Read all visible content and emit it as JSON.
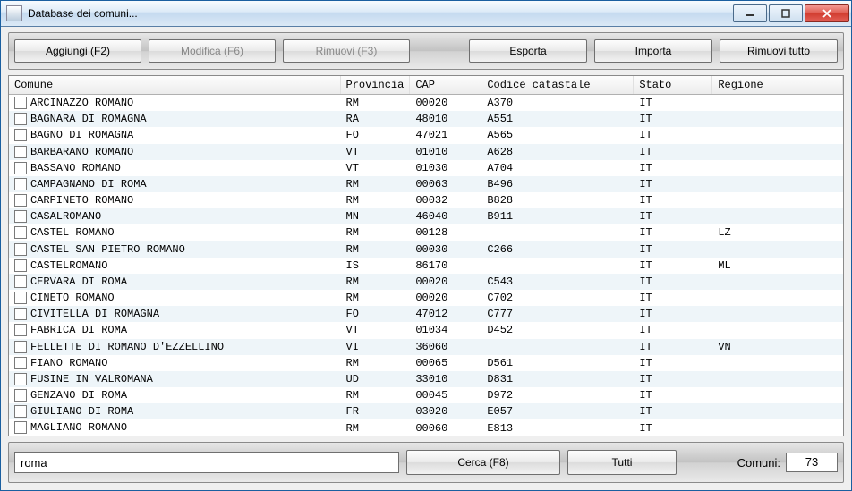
{
  "window": {
    "title": "Database dei comuni..."
  },
  "toolbar": {
    "aggiungi": "Aggiungi (F2)",
    "modifica": "Modifica (F6)",
    "rimuovi": "Rimuovi (F3)",
    "esporta": "Esporta",
    "importa": "Importa",
    "rimuovi_tutto": "Rimuovi tutto"
  },
  "columns": {
    "comune": "Comune",
    "provincia": "Provincia",
    "cap": "CAP",
    "codice": "Codice catastale",
    "stato": "Stato",
    "regione": "Regione"
  },
  "rows": [
    {
      "comune": "ARCINAZZO ROMANO",
      "provincia": "RM",
      "cap": "00020",
      "codice": "A370",
      "stato": "IT",
      "regione": ""
    },
    {
      "comune": "BAGNARA DI ROMAGNA",
      "provincia": "RA",
      "cap": "48010",
      "codice": "A551",
      "stato": "IT",
      "regione": ""
    },
    {
      "comune": "BAGNO DI ROMAGNA",
      "provincia": "FO",
      "cap": "47021",
      "codice": "A565",
      "stato": "IT",
      "regione": ""
    },
    {
      "comune": "BARBARANO ROMANO",
      "provincia": "VT",
      "cap": "01010",
      "codice": "A628",
      "stato": "IT",
      "regione": ""
    },
    {
      "comune": "BASSANO ROMANO",
      "provincia": "VT",
      "cap": "01030",
      "codice": "A704",
      "stato": "IT",
      "regione": ""
    },
    {
      "comune": "CAMPAGNANO DI ROMA",
      "provincia": "RM",
      "cap": "00063",
      "codice": "B496",
      "stato": "IT",
      "regione": ""
    },
    {
      "comune": "CARPINETO ROMANO",
      "provincia": "RM",
      "cap": "00032",
      "codice": "B828",
      "stato": "IT",
      "regione": ""
    },
    {
      "comune": "CASALROMANO",
      "provincia": "MN",
      "cap": "46040",
      "codice": "B911",
      "stato": "IT",
      "regione": ""
    },
    {
      "comune": "CASTEL ROMANO",
      "provincia": "RM",
      "cap": "00128",
      "codice": "",
      "stato": "IT",
      "regione": "LZ"
    },
    {
      "comune": "CASTEL SAN PIETRO ROMANO",
      "provincia": "RM",
      "cap": "00030",
      "codice": "C266",
      "stato": "IT",
      "regione": ""
    },
    {
      "comune": "CASTELROMANO",
      "provincia": "IS",
      "cap": "86170",
      "codice": "",
      "stato": "IT",
      "regione": "ML"
    },
    {
      "comune": "CERVARA DI ROMA",
      "provincia": "RM",
      "cap": "00020",
      "codice": "C543",
      "stato": "IT",
      "regione": ""
    },
    {
      "comune": "CINETO ROMANO",
      "provincia": "RM",
      "cap": "00020",
      "codice": "C702",
      "stato": "IT",
      "regione": ""
    },
    {
      "comune": "CIVITELLA DI ROMAGNA",
      "provincia": "FO",
      "cap": "47012",
      "codice": "C777",
      "stato": "IT",
      "regione": ""
    },
    {
      "comune": "FABRICA DI ROMA",
      "provincia": "VT",
      "cap": "01034",
      "codice": "D452",
      "stato": "IT",
      "regione": ""
    },
    {
      "comune": "FELLETTE DI ROMANO D'EZZELLINO",
      "provincia": "VI",
      "cap": "36060",
      "codice": "",
      "stato": "IT",
      "regione": "VN"
    },
    {
      "comune": "FIANO ROMANO",
      "provincia": "RM",
      "cap": "00065",
      "codice": "D561",
      "stato": "IT",
      "regione": ""
    },
    {
      "comune": "FUSINE IN VALROMANA",
      "provincia": "UD",
      "cap": "33010",
      "codice": "D831",
      "stato": "IT",
      "regione": ""
    },
    {
      "comune": "GENZANO DI ROMA",
      "provincia": "RM",
      "cap": "00045",
      "codice": "D972",
      "stato": "IT",
      "regione": ""
    },
    {
      "comune": "GIULIANO DI ROMA",
      "provincia": "FR",
      "cap": "03020",
      "codice": "E057",
      "stato": "IT",
      "regione": ""
    },
    {
      "comune": "MAGLIANO ROMANO",
      "provincia": "RM",
      "cap": "00060",
      "codice": "E813",
      "stato": "IT",
      "regione": ""
    }
  ],
  "search": {
    "value": "roma"
  },
  "bottom": {
    "cerca": "Cerca  (F8)",
    "tutti": "Tutti",
    "count_label": "Comuni:",
    "count_value": "73"
  }
}
